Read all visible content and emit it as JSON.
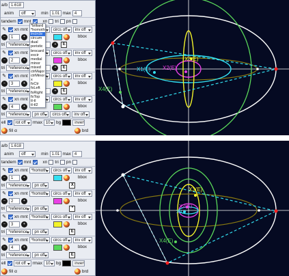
{
  "gap": "",
  "top": {
    "header": {
      "ratio_label": "a/b",
      "ratio_value": "1.618",
      "anim_label": "anim",
      "anim_value": "off",
      "min_label": "min",
      "min_value": "1.01",
      "max_label": "max",
      "max_value": "4"
    },
    "opts": {
      "tandem_label": "tandem",
      "mnt_label": "mnt",
      "xn_label": "xn",
      "tri_label": "tri",
      "pn_label": "pn"
    },
    "rows": [
      {
        "xn": "xn",
        "mnt": "mnt",
        "mount": "*billiard",
        "circs": "circs off",
        "inv": "inv off",
        "num": "1",
        "tri": "tri",
        "tri_sel": "*reference",
        "pn": "pn off",
        "bbox": "bbox",
        "btn": "E",
        "color": "#33e0f2"
      },
      {
        "xn": "xn",
        "mnt": "mnt",
        "mount": "*homoth",
        "circs": "circs off",
        "inv": "inv off",
        "num": "2",
        "tri": "tri",
        "tri_sel": "*reference",
        "pn": "pn off",
        "bbox": "bbox",
        "btn": "E",
        "color": "#ea3fe6"
      },
      {
        "xn": "xn",
        "mnt": "mnt",
        "mount": "*homoth",
        "circs": "circs off",
        "inv": "inv off",
        "num": "3",
        "tri": "tri",
        "tri_sel": "*reference",
        "pn": "pn off",
        "bbox": "bbox",
        "btn": "E",
        "color": "#f3f32a"
      },
      {
        "xn": "xn",
        "mnt": "mnt",
        "mount": "*homoth",
        "circs": "circs off",
        "inv": "inv off",
        "num": "4",
        "tri": "tri",
        "tri_sel": "*reference",
        "pn": "pn off",
        "bbox": "bbox",
        "btn": "E",
        "color": "#5ad85a"
      }
    ],
    "footer": {
      "ell_label": "ell",
      "rot": "rot off",
      "rmax_label": "rmax",
      "rmax_value": "10",
      "bg_label": "bg",
      "bg_color": "#000000",
      "invert": "invert",
      "fill_label": "fill",
      "fill_value": "α",
      "brd_label": "brd"
    },
    "dropdown": [
      "*billiard",
      "*homoth",
      "incircle",
      "circum",
      "dual",
      "poristic",
      "brocard",
      "excir",
      "medial",
      "minor",
      "mixed",
      "ctrMajor",
      "ctrMinor",
      "x",
      "fsCtr",
      "fsLeft",
      "fsRight",
      "fsTop",
      "tl-tl",
      "tl-tl2"
    ],
    "dropdown_selected": 2,
    "labels": [
      "X3(E)",
      "X1(E)",
      "X2(E)",
      "X4(E)"
    ]
  },
  "bottom": {
    "header": {
      "ratio_label": "a/b",
      "ratio_value": "1.618",
      "anim_label": "anim",
      "anim_value": "off",
      "min_label": "min",
      "min_value": "1.01",
      "max_label": "max",
      "max_value": "4"
    },
    "opts": {
      "tandem_label": "tandem",
      "mnt_label": "mnt",
      "xn_label": "xn",
      "tri_label": "tri",
      "pn_label": "pn"
    },
    "rows": [
      {
        "xn": "xn",
        "mnt": "mnt",
        "mount": "*homoth",
        "circs": "circs off",
        "inv": "inv off",
        "num": "1",
        "tri": "tri",
        "tri_sel": "*reference",
        "pn": "pn off",
        "bbox": "bbox",
        "btn": "X",
        "color": "#33e0f2"
      },
      {
        "xn": "xn",
        "mnt": "mnt",
        "mount": "*homoth",
        "circs": "circs off",
        "inv": "inv off",
        "num": "2",
        "tri": "tri",
        "tri_sel": "*reference",
        "pn": "pn off",
        "bbox": "bbox",
        "btn": "*",
        "color": "#ea3fe6"
      },
      {
        "xn": "xn",
        "mnt": "mnt",
        "mount": "*homoth",
        "circs": "circs off",
        "inv": "inv off",
        "num": "3",
        "tri": "tri",
        "tri_sel": "*reference",
        "pn": "pn off",
        "bbox": "bbox",
        "btn": "E",
        "color": "#f3f32a"
      },
      {
        "xn": "xn",
        "mnt": "mnt",
        "mount": "*homoth",
        "circs": "circs off",
        "inv": "inv off",
        "num": "4",
        "tri": "tri",
        "tri_sel": "*reference",
        "pn": "pn off",
        "bbox": "bbox",
        "btn": "E",
        "color": "#5ad85a"
      }
    ],
    "footer": {
      "ell_label": "ell",
      "rot": "rot off",
      "rmax_label": "rmax",
      "rmax_value": "10",
      "bg_label": "bg",
      "bg_color": "#000000",
      "invert": "invert",
      "fill_label": "fill",
      "fill_value": "α",
      "brd_label": "brd"
    },
    "labels": [
      "X3(E)",
      "X2(E)",
      "X1",
      "X4(E)"
    ]
  },
  "colors": {
    "canvas_bg": "#050a22",
    "ellipse": "#ffffff",
    "cyan": "#33e0f2",
    "magenta": "#ea3fe6",
    "yellow": "#f3f32a",
    "green": "#5ad85a",
    "olive": "#8a7a10",
    "red": "#ff2020"
  }
}
